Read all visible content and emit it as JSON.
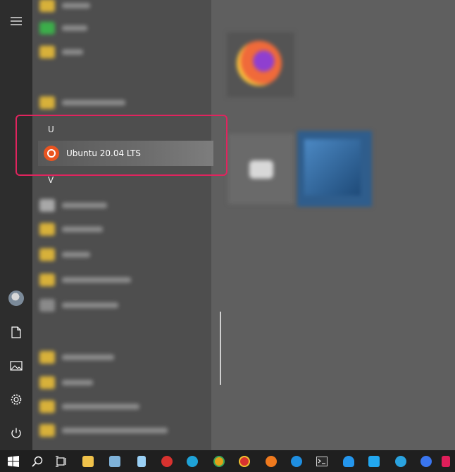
{
  "start_menu": {
    "section_u": "U",
    "section_v": "V",
    "highlighted_app": {
      "label": "Ubuntu 20.04 LTS",
      "icon": "ubuntu-logo-icon"
    }
  },
  "rail": {
    "items": [
      {
        "name": "expand",
        "icon": "hamburger-menu-icon"
      },
      {
        "name": "user",
        "icon": "user-avatar-icon"
      },
      {
        "name": "documents",
        "icon": "document-icon"
      },
      {
        "name": "pictures",
        "icon": "pictures-icon"
      },
      {
        "name": "settings",
        "icon": "gear-icon"
      },
      {
        "name": "power",
        "icon": "power-icon"
      }
    ]
  },
  "taskbar": {
    "items": [
      {
        "name": "start",
        "icon": "windows-logo-icon"
      },
      {
        "name": "search",
        "icon": "search-icon"
      },
      {
        "name": "task-view",
        "icon": "task-view-icon"
      },
      {
        "name": "file-explorer",
        "icon": "folder-icon",
        "color": "#f0c24b"
      },
      {
        "name": "app-image",
        "icon": "image-app-icon",
        "color": "#7fb2d9"
      },
      {
        "name": "notepad",
        "icon": "notepad-icon",
        "color": "#9ad0f5"
      },
      {
        "name": "app-red",
        "icon": "network-app-icon",
        "color": "#d8322f"
      },
      {
        "name": "edge",
        "icon": "edge-icon",
        "color": "#1fa3d8"
      },
      {
        "name": "chrome",
        "icon": "chrome-icon",
        "color": "#e4a118"
      },
      {
        "name": "chrome-alt",
        "icon": "chrome-icon",
        "color": "#d8322f"
      },
      {
        "name": "firefox",
        "icon": "firefox-icon",
        "color": "#f07a1e"
      },
      {
        "name": "firefox-dev",
        "icon": "firefox-dev-icon",
        "color": "#1f8ee0"
      },
      {
        "name": "terminal",
        "icon": "terminal-icon",
        "color": "#3a3a3a"
      },
      {
        "name": "docker",
        "icon": "docker-icon",
        "color": "#2496ed"
      },
      {
        "name": "vscode",
        "icon": "vscode-icon",
        "color": "#22a7f0"
      },
      {
        "name": "telegram",
        "icon": "telegram-icon",
        "color": "#2aa3e0"
      },
      {
        "name": "signal",
        "icon": "chat-icon",
        "color": "#3a76f0"
      },
      {
        "name": "slack",
        "icon": "slack-icon",
        "color": "#e01e5a"
      }
    ]
  }
}
